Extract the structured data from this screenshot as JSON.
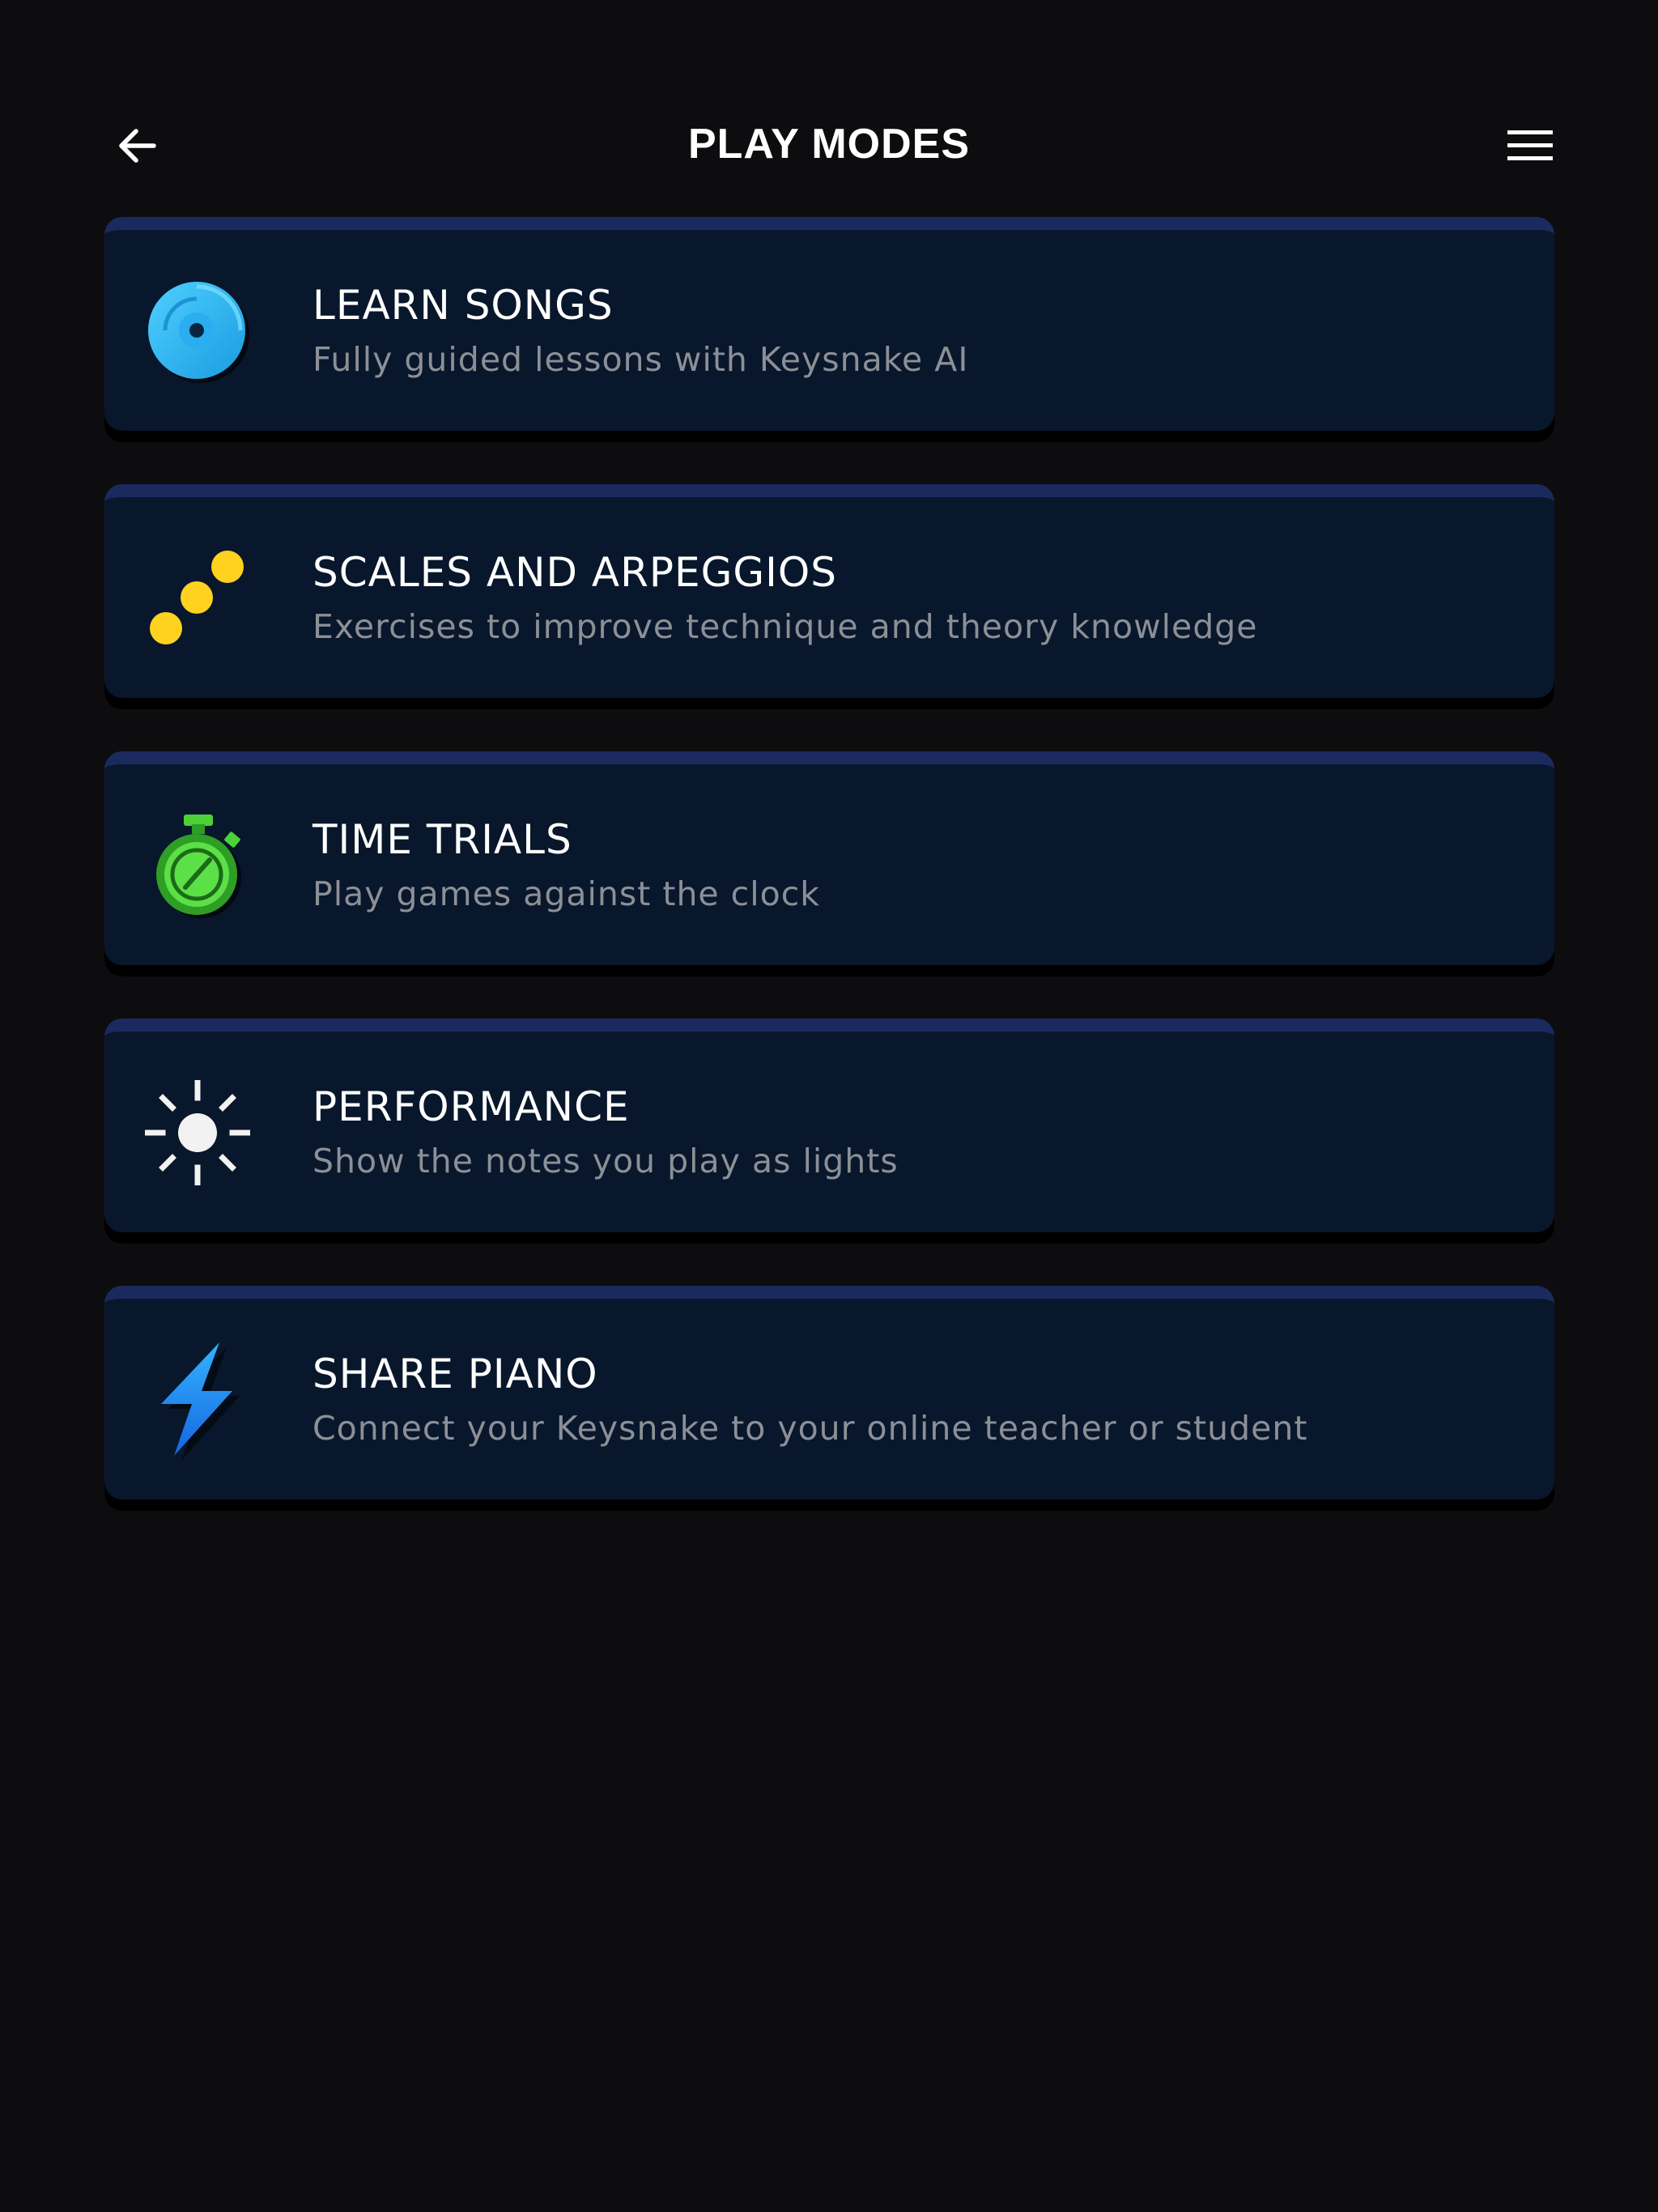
{
  "header": {
    "title": "PLAY MODES",
    "back_icon": "arrow-left-icon",
    "menu_icon": "hamburger-menu-icon"
  },
  "modes": [
    {
      "title": "LEARN SONGS",
      "subtitle": "Fully guided lessons with Keysnake AI",
      "icon": "music-disc-icon",
      "icon_color": "#29b6f6"
    },
    {
      "title": "SCALES AND ARPEGGIOS",
      "subtitle": "Exercises to improve technique and theory knowledge",
      "icon": "ascending-dots-icon",
      "icon_color": "#ffd21f"
    },
    {
      "title": "TIME TRIALS",
      "subtitle": "Play games against the clock",
      "icon": "stopwatch-icon",
      "icon_color": "#4cd137"
    },
    {
      "title": "PERFORMANCE",
      "subtitle": "Show the notes you play as lights",
      "icon": "light-burst-icon",
      "icon_color": "#f2f2f2"
    },
    {
      "title": "SHARE PIANO",
      "subtitle": "Connect your Keysnake to your online teacher or student",
      "icon": "lightning-bolt-icon",
      "icon_color": "#1e88e5"
    }
  ],
  "colors": {
    "background": "#0d0d0f",
    "card": "#08172b",
    "card_top": "#1b2a5e",
    "subtitle": "#8c8f96"
  }
}
